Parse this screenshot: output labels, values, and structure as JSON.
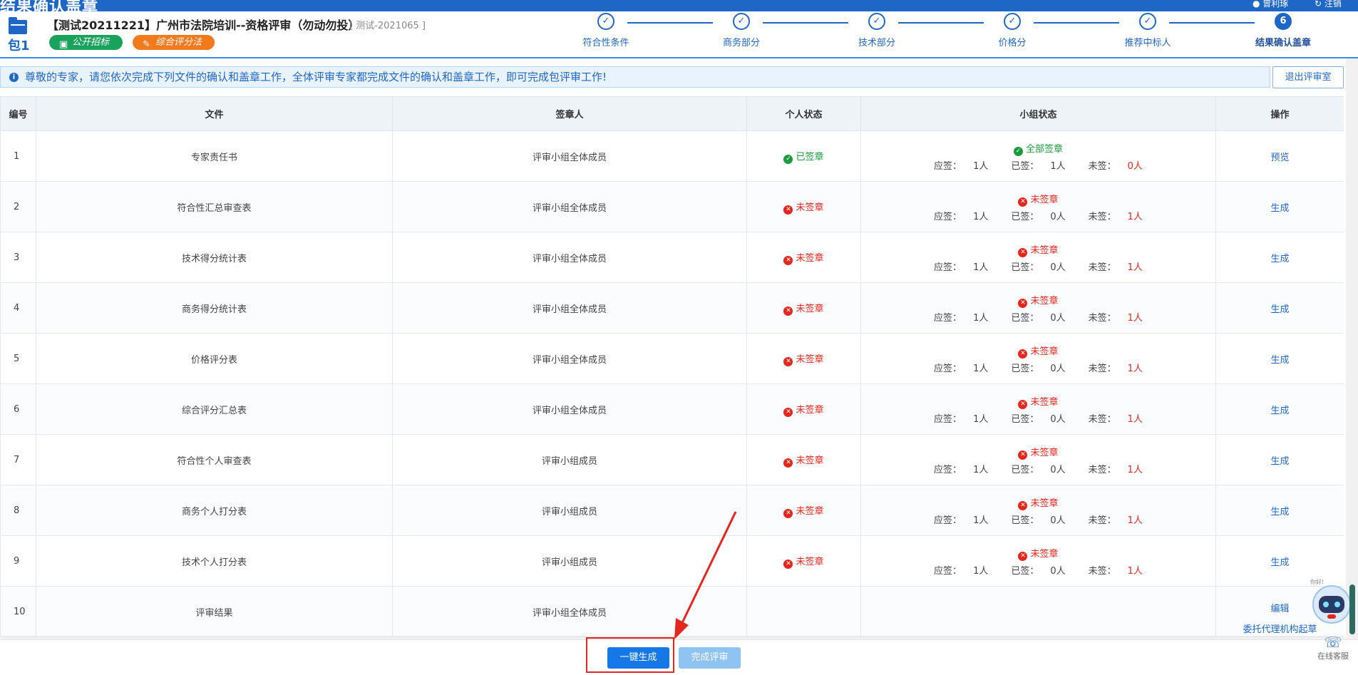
{
  "app": {
    "title": "结果确认盖章",
    "user": "曾利琢",
    "logout": "注销"
  },
  "header": {
    "package_label": "包1",
    "project_title": "【测试20211221】广州市法院培训--资格评审（勿动勿投）",
    "project_code": "[ 测试-2021065 ]",
    "tags": [
      {
        "label": "公开招标",
        "color": "#19a25b"
      },
      {
        "label": "综合评分法",
        "color": "#f27a1c"
      }
    ]
  },
  "steps": [
    {
      "label": "符合性条件",
      "mark": "✓"
    },
    {
      "label": "商务部分",
      "mark": "✓"
    },
    {
      "label": "技术部分",
      "mark": "✓"
    },
    {
      "label": "价格分",
      "mark": "✓"
    },
    {
      "label": "推荐中标人",
      "mark": "✓"
    },
    {
      "label": "结果确认盖章",
      "mark": "6",
      "active": true
    }
  ],
  "notice": "尊敬的专家，请您依次完成下列文件的确认和盖章工作，全体评审专家都完成文件的确认和盖章工作，即可完成包评审工作!",
  "exit_button": "退出评审室",
  "table": {
    "headers": [
      "编号",
      "文件",
      "签章人",
      "个人状态",
      "小组状态",
      "操作"
    ],
    "count_labels": {
      "should": "应签：",
      "signed": "已签：",
      "unsigned": "未签："
    },
    "rows": [
      {
        "no": "1",
        "file": "专家责任书",
        "signer": "评审小组全体成员",
        "personal": "已签章",
        "personal_ok": true,
        "group": "全部签章",
        "group_ok": true,
        "should": "1人",
        "signed": "1人",
        "unsigned": "0人",
        "op": "预览"
      },
      {
        "no": "2",
        "file": "符合性汇总审查表",
        "signer": "评审小组全体成员",
        "personal": "未签章",
        "personal_ok": false,
        "group": "未签章",
        "group_ok": false,
        "should": "1人",
        "signed": "0人",
        "unsigned": "1人",
        "op": "生成"
      },
      {
        "no": "3",
        "file": "技术得分统计表",
        "signer": "评审小组全体成员",
        "personal": "未签章",
        "personal_ok": false,
        "group": "未签章",
        "group_ok": false,
        "should": "1人",
        "signed": "0人",
        "unsigned": "1人",
        "op": "生成"
      },
      {
        "no": "4",
        "file": "商务得分统计表",
        "signer": "评审小组全体成员",
        "personal": "未签章",
        "personal_ok": false,
        "group": "未签章",
        "group_ok": false,
        "should": "1人",
        "signed": "0人",
        "unsigned": "1人",
        "op": "生成"
      },
      {
        "no": "5",
        "file": "价格评分表",
        "signer": "评审小组全体成员",
        "personal": "未签章",
        "personal_ok": false,
        "group": "未签章",
        "group_ok": false,
        "should": "1人",
        "signed": "0人",
        "unsigned": "1人",
        "op": "生成"
      },
      {
        "no": "6",
        "file": "综合评分汇总表",
        "signer": "评审小组全体成员",
        "personal": "未签章",
        "personal_ok": false,
        "group": "未签章",
        "group_ok": false,
        "should": "1人",
        "signed": "0人",
        "unsigned": "1人",
        "op": "生成"
      },
      {
        "no": "7",
        "file": "符合性个人审查表",
        "signer": "评审小组成员",
        "personal": "未签章",
        "personal_ok": false,
        "group": "未签章",
        "group_ok": false,
        "should": "1人",
        "signed": "0人",
        "unsigned": "1人",
        "op": "生成"
      },
      {
        "no": "8",
        "file": "商务个人打分表",
        "signer": "评审小组成员",
        "personal": "未签章",
        "personal_ok": false,
        "group": "未签章",
        "group_ok": false,
        "should": "1人",
        "signed": "0人",
        "unsigned": "1人",
        "op": "生成"
      },
      {
        "no": "9",
        "file": "技术个人打分表",
        "signer": "评审小组成员",
        "personal": "未签章",
        "personal_ok": false,
        "group": "未签章",
        "group_ok": false,
        "should": "1人",
        "signed": "0人",
        "unsigned": "1人",
        "op": "生成"
      }
    ],
    "last_row": {
      "no": "10",
      "file": "评审结果",
      "signer": "评审小组全体成员",
      "op1": "编辑",
      "op2": "委托代理机构起草"
    }
  },
  "bottom": {
    "generate_all": "一键生成",
    "finish": "完成评审"
  },
  "assistant": {
    "greeting": "你好!",
    "service": "在线客服"
  },
  "colors": {
    "primary": "#1f67c7",
    "success": "#1a9b3c",
    "danger": "#e5261d"
  }
}
